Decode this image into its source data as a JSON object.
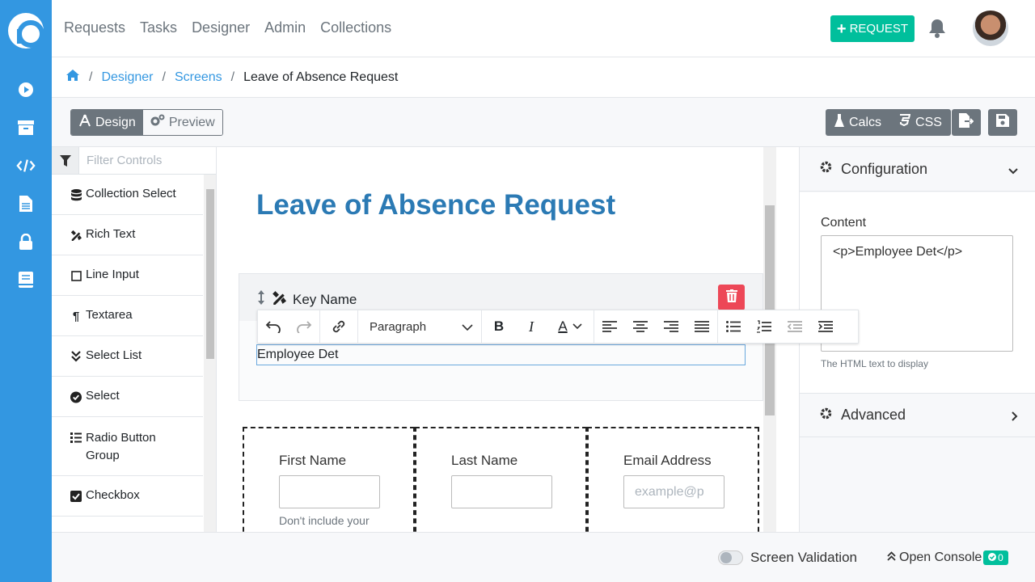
{
  "nav": {
    "items": [
      "Requests",
      "Tasks",
      "Designer",
      "Admin",
      "Collections"
    ],
    "request_button": "REQUEST"
  },
  "breadcrumb": {
    "items": [
      "Designer",
      "Screens"
    ],
    "current": "Leave of Absence Request"
  },
  "toolbar": {
    "design_label": "Design",
    "preview_label": "Preview",
    "calcs_label": "Calcs",
    "css_label": "CSS"
  },
  "palette": {
    "filter_placeholder": "Filter Controls",
    "items": [
      {
        "label": "Collection Select",
        "icon": "database-icon"
      },
      {
        "label": "Rich Text",
        "icon": "pencil-ruler-icon"
      },
      {
        "label": "Line Input",
        "icon": "square-icon"
      },
      {
        "label": "Textarea",
        "icon": "paragraph-icon"
      },
      {
        "label": "Select List",
        "icon": "double-chevron-down-icon"
      },
      {
        "label": "Select",
        "icon": "check-circle-icon"
      },
      {
        "label": "Radio Button Group",
        "icon": "list-icon"
      },
      {
        "label": "Checkbox",
        "icon": "check-square-icon"
      }
    ]
  },
  "canvas": {
    "title": "Leave of Absence Request",
    "key_label": "Key Name",
    "editor_text": "Employee Det",
    "format_select": "Paragraph",
    "columns": [
      {
        "label": "First Name",
        "placeholder": "",
        "help": "Don't include your"
      },
      {
        "label": "Last Name",
        "placeholder": "",
        "help": ""
      },
      {
        "label": "Email Address",
        "placeholder": "example@p",
        "help": ""
      }
    ]
  },
  "inspector": {
    "configuration_label": "Configuration",
    "content_label": "Content",
    "content_value": "<p>Employee Det</p>",
    "content_hint": "The HTML text to display",
    "advanced_label": "Advanced"
  },
  "footer": {
    "screen_validation": "Screen Validation",
    "open_console": "Open Console",
    "console_count": "0"
  },
  "colors": {
    "rail": "#3397e1",
    "accent_green": "#00bf9c",
    "title_blue": "#2b7ab4",
    "danger": "#ed4757"
  }
}
